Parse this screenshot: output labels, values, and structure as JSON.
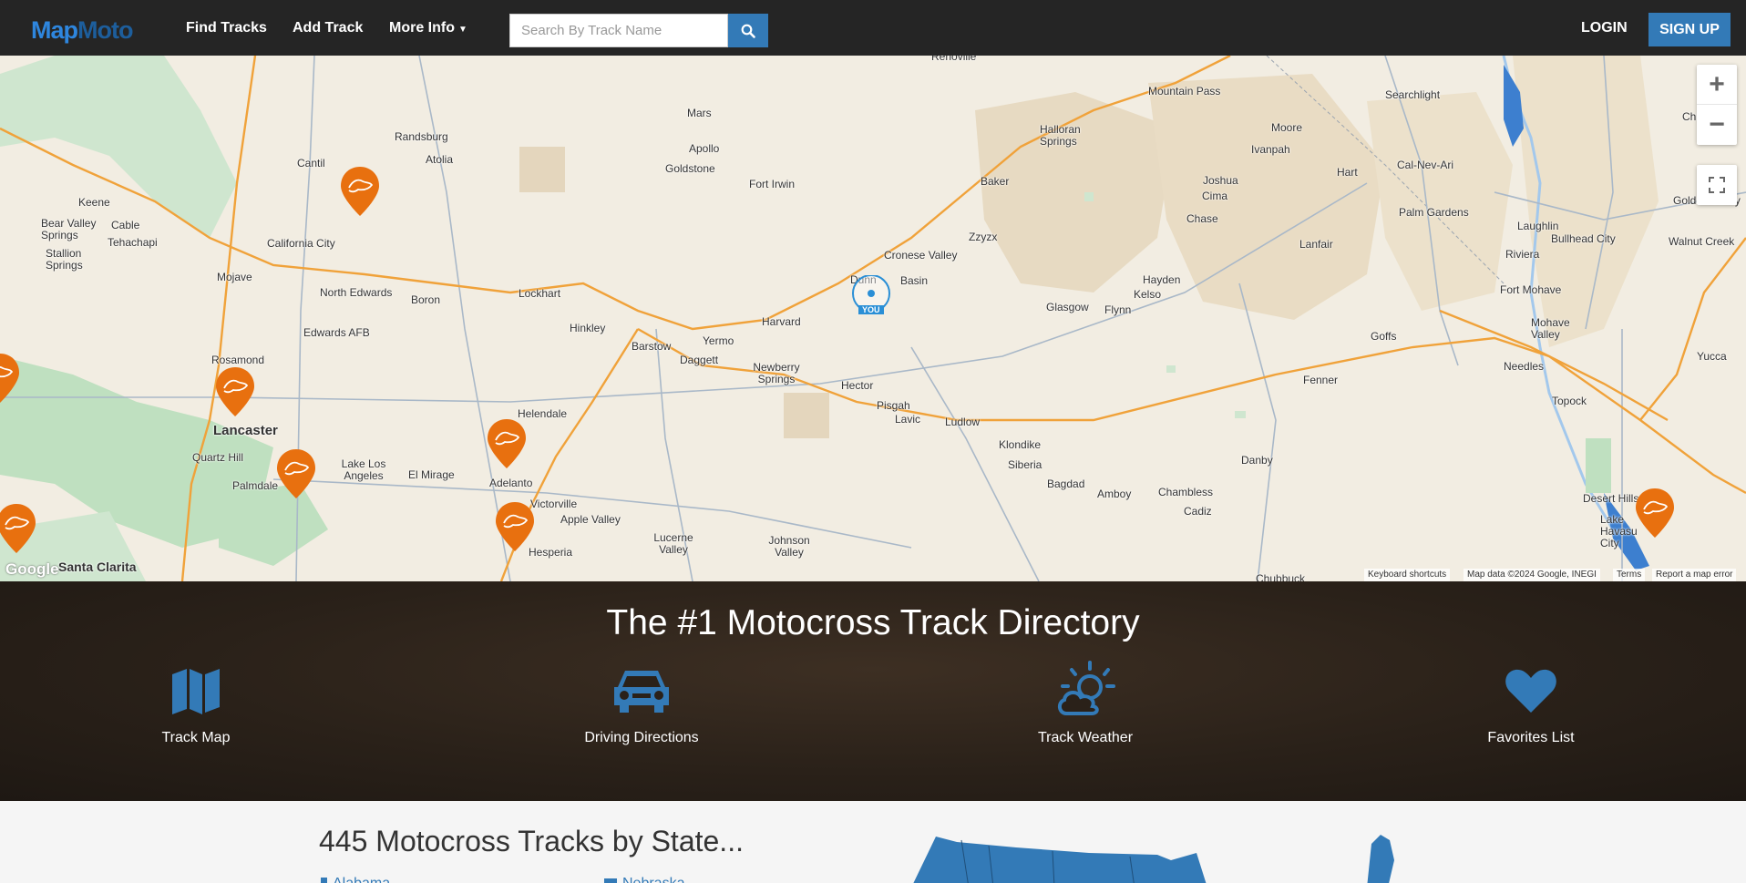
{
  "brand": {
    "logo_part1": "Map",
    "logo_part2": "Moto"
  },
  "nav": {
    "find_tracks": "Find Tracks",
    "add_track": "Add Track",
    "more_info": "More Info",
    "login": "LOGIN",
    "signup": "SIGN UP"
  },
  "search": {
    "placeholder": "Search By Track Name"
  },
  "map": {
    "places": [
      "Renoville",
      "Mountain Pass",
      "Searchlight",
      "Chloride",
      "Mars",
      "Randsburg",
      "Apollo",
      "Goldstone",
      "Fort Irwin",
      "Halloran Springs",
      "Moore",
      "Ivanpah",
      "Hart",
      "Cal-Nev-Ari",
      "Atolia",
      "Cantil",
      "Baker",
      "Joshua",
      "Cima",
      "Keene",
      "Cable",
      "Bear Valley Springs",
      "Tehachapi",
      "Stallion Springs",
      "California City",
      "Chase",
      "Palm Gardens",
      "Laughlin",
      "Bullhead City",
      "Golden Valley",
      "Walnut Creek",
      "Zzyzx",
      "Lanfair",
      "Riviera",
      "Cronese Valley",
      "Mojave",
      "Dunn",
      "Basin",
      "Hayden",
      "Kelso",
      "North Edwards",
      "Boron",
      "Lockhart",
      "Fort Mohave",
      "Glasgow",
      "Flynn",
      "Harvard",
      "Edwards AFB",
      "Hinkley",
      "Mohave Valley",
      "Goffs",
      "Barstow",
      "Yermo",
      "Daggett",
      "Yucca",
      "Needles",
      "Rosamond",
      "Newberry Springs",
      "Hector",
      "Fenner",
      "Topock",
      "Pisgah",
      "Lancaster",
      "Lavic",
      "Ludlow",
      "Helendale",
      "Quartz Hill",
      "Lake Los Angeles",
      "Klondike",
      "Siberia",
      "Danby",
      "Palmdale",
      "El Mirage",
      "Bagdad",
      "Amboy",
      "Chambless",
      "Adelanto",
      "Desert Hills",
      "Cadiz",
      "Victorville",
      "Apple Valley",
      "Lake Havasu City",
      "Lucerne Valley",
      "Johnson Valley",
      "Hesperia",
      "Santa Clarita",
      "Chubbuck"
    ],
    "you_label": "YOU",
    "attribution": {
      "shortcuts": "Keyboard shortcuts",
      "data": "Map data ©2024 Google, INEGI",
      "terms": "Terms",
      "report": "Report a map error"
    },
    "google_logo": "Google"
  },
  "hero": {
    "title": "The #1 Motocross Track Directory",
    "features": [
      {
        "label": "Track Map",
        "icon": "map-icon"
      },
      {
        "label": "Driving Directions",
        "icon": "car-icon"
      },
      {
        "label": "Track Weather",
        "icon": "weather-icon"
      },
      {
        "label": "Favorites List",
        "icon": "heart-icon"
      }
    ]
  },
  "states": {
    "title": "445 Motocross Tracks by State...",
    "links": [
      "Alabama",
      "Nebraska"
    ]
  },
  "colors": {
    "accent": "#337ab7",
    "marker": "#e8700f",
    "nav_bg": "#252525"
  }
}
